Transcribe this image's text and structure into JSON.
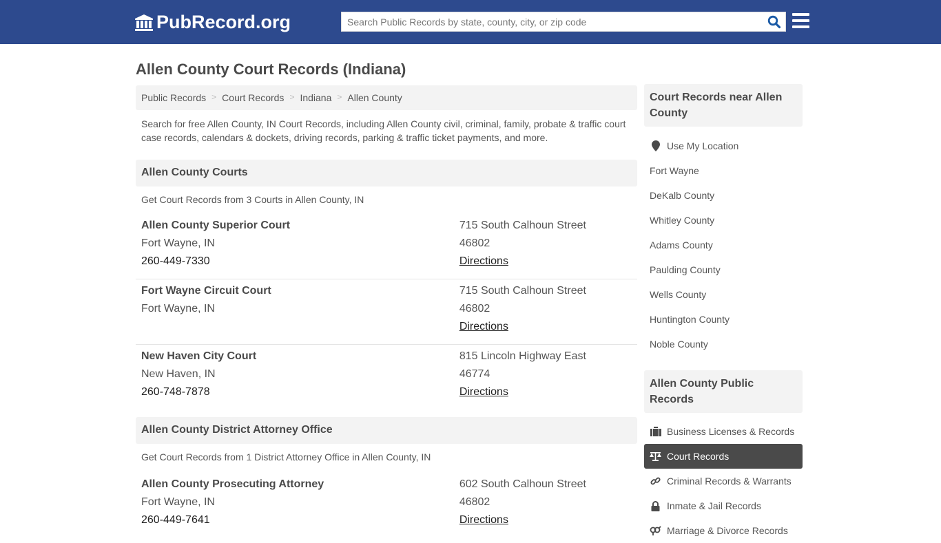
{
  "header": {
    "logo_text": "PubRecord.org",
    "search_placeholder": "Search Public Records by state, county, city, or zip code",
    "colors": {
      "bar": "#2d4a8e",
      "search_icon": "#1a5aa6"
    }
  },
  "page_title": "Allen County Court Records (Indiana)",
  "breadcrumb": [
    "Public Records",
    "Court Records",
    "Indiana",
    "Allen County"
  ],
  "intro": "Search for free Allen County, IN Court Records, including Allen County civil, criminal, family, probate & traffic court case records, calendars & dockets, driving records, parking & traffic ticket payments, and more.",
  "sections": [
    {
      "title": "Allen County Courts",
      "subtitle": "Get Court Records from 3 Courts in Allen County, IN",
      "entries": [
        {
          "name": "Allen County Superior Court",
          "city": "Fort Wayne, IN",
          "phone": "260-449-7330",
          "address": "715 South Calhoun Street",
          "zip": "46802",
          "link": "Directions"
        },
        {
          "name": "Fort Wayne Circuit Court",
          "city": "Fort Wayne, IN",
          "phone": "",
          "address": "715 South Calhoun Street",
          "zip": "46802",
          "link": "Directions"
        },
        {
          "name": "New Haven City Court",
          "city": "New Haven, IN",
          "phone": "260-748-7878",
          "address": "815 Lincoln Highway East",
          "zip": "46774",
          "link": "Directions"
        }
      ]
    },
    {
      "title": "Allen County District Attorney Office",
      "subtitle": "Get Court Records from 1 District Attorney Office in Allen County, IN",
      "entries": [
        {
          "name": "Allen County Prosecuting Attorney",
          "city": "Fort Wayne, IN",
          "phone": "260-449-7641",
          "address": "602 South Calhoun Street",
          "zip": "46802",
          "link": "Directions"
        }
      ]
    }
  ],
  "sidebar": {
    "nearby": {
      "title": "Court Records near Allen County",
      "location_label": "Use My Location",
      "items": [
        "Fort Wayne",
        "DeKalb County",
        "Whitley County",
        "Adams County",
        "Paulding County",
        "Wells County",
        "Huntington County",
        "Noble County"
      ]
    },
    "public_records": {
      "title": "Allen County Public Records",
      "items": [
        {
          "label": "Business Licenses & Records",
          "icon": "briefcase-icon",
          "active": false
        },
        {
          "label": "Court Records",
          "icon": "scale-icon",
          "active": true
        },
        {
          "label": "Criminal Records & Warrants",
          "icon": "link-icon",
          "active": false
        },
        {
          "label": "Inmate & Jail Records",
          "icon": "lock-icon",
          "active": false
        },
        {
          "label": "Marriage & Divorce Records",
          "icon": "gender-icon",
          "active": false
        }
      ]
    }
  }
}
